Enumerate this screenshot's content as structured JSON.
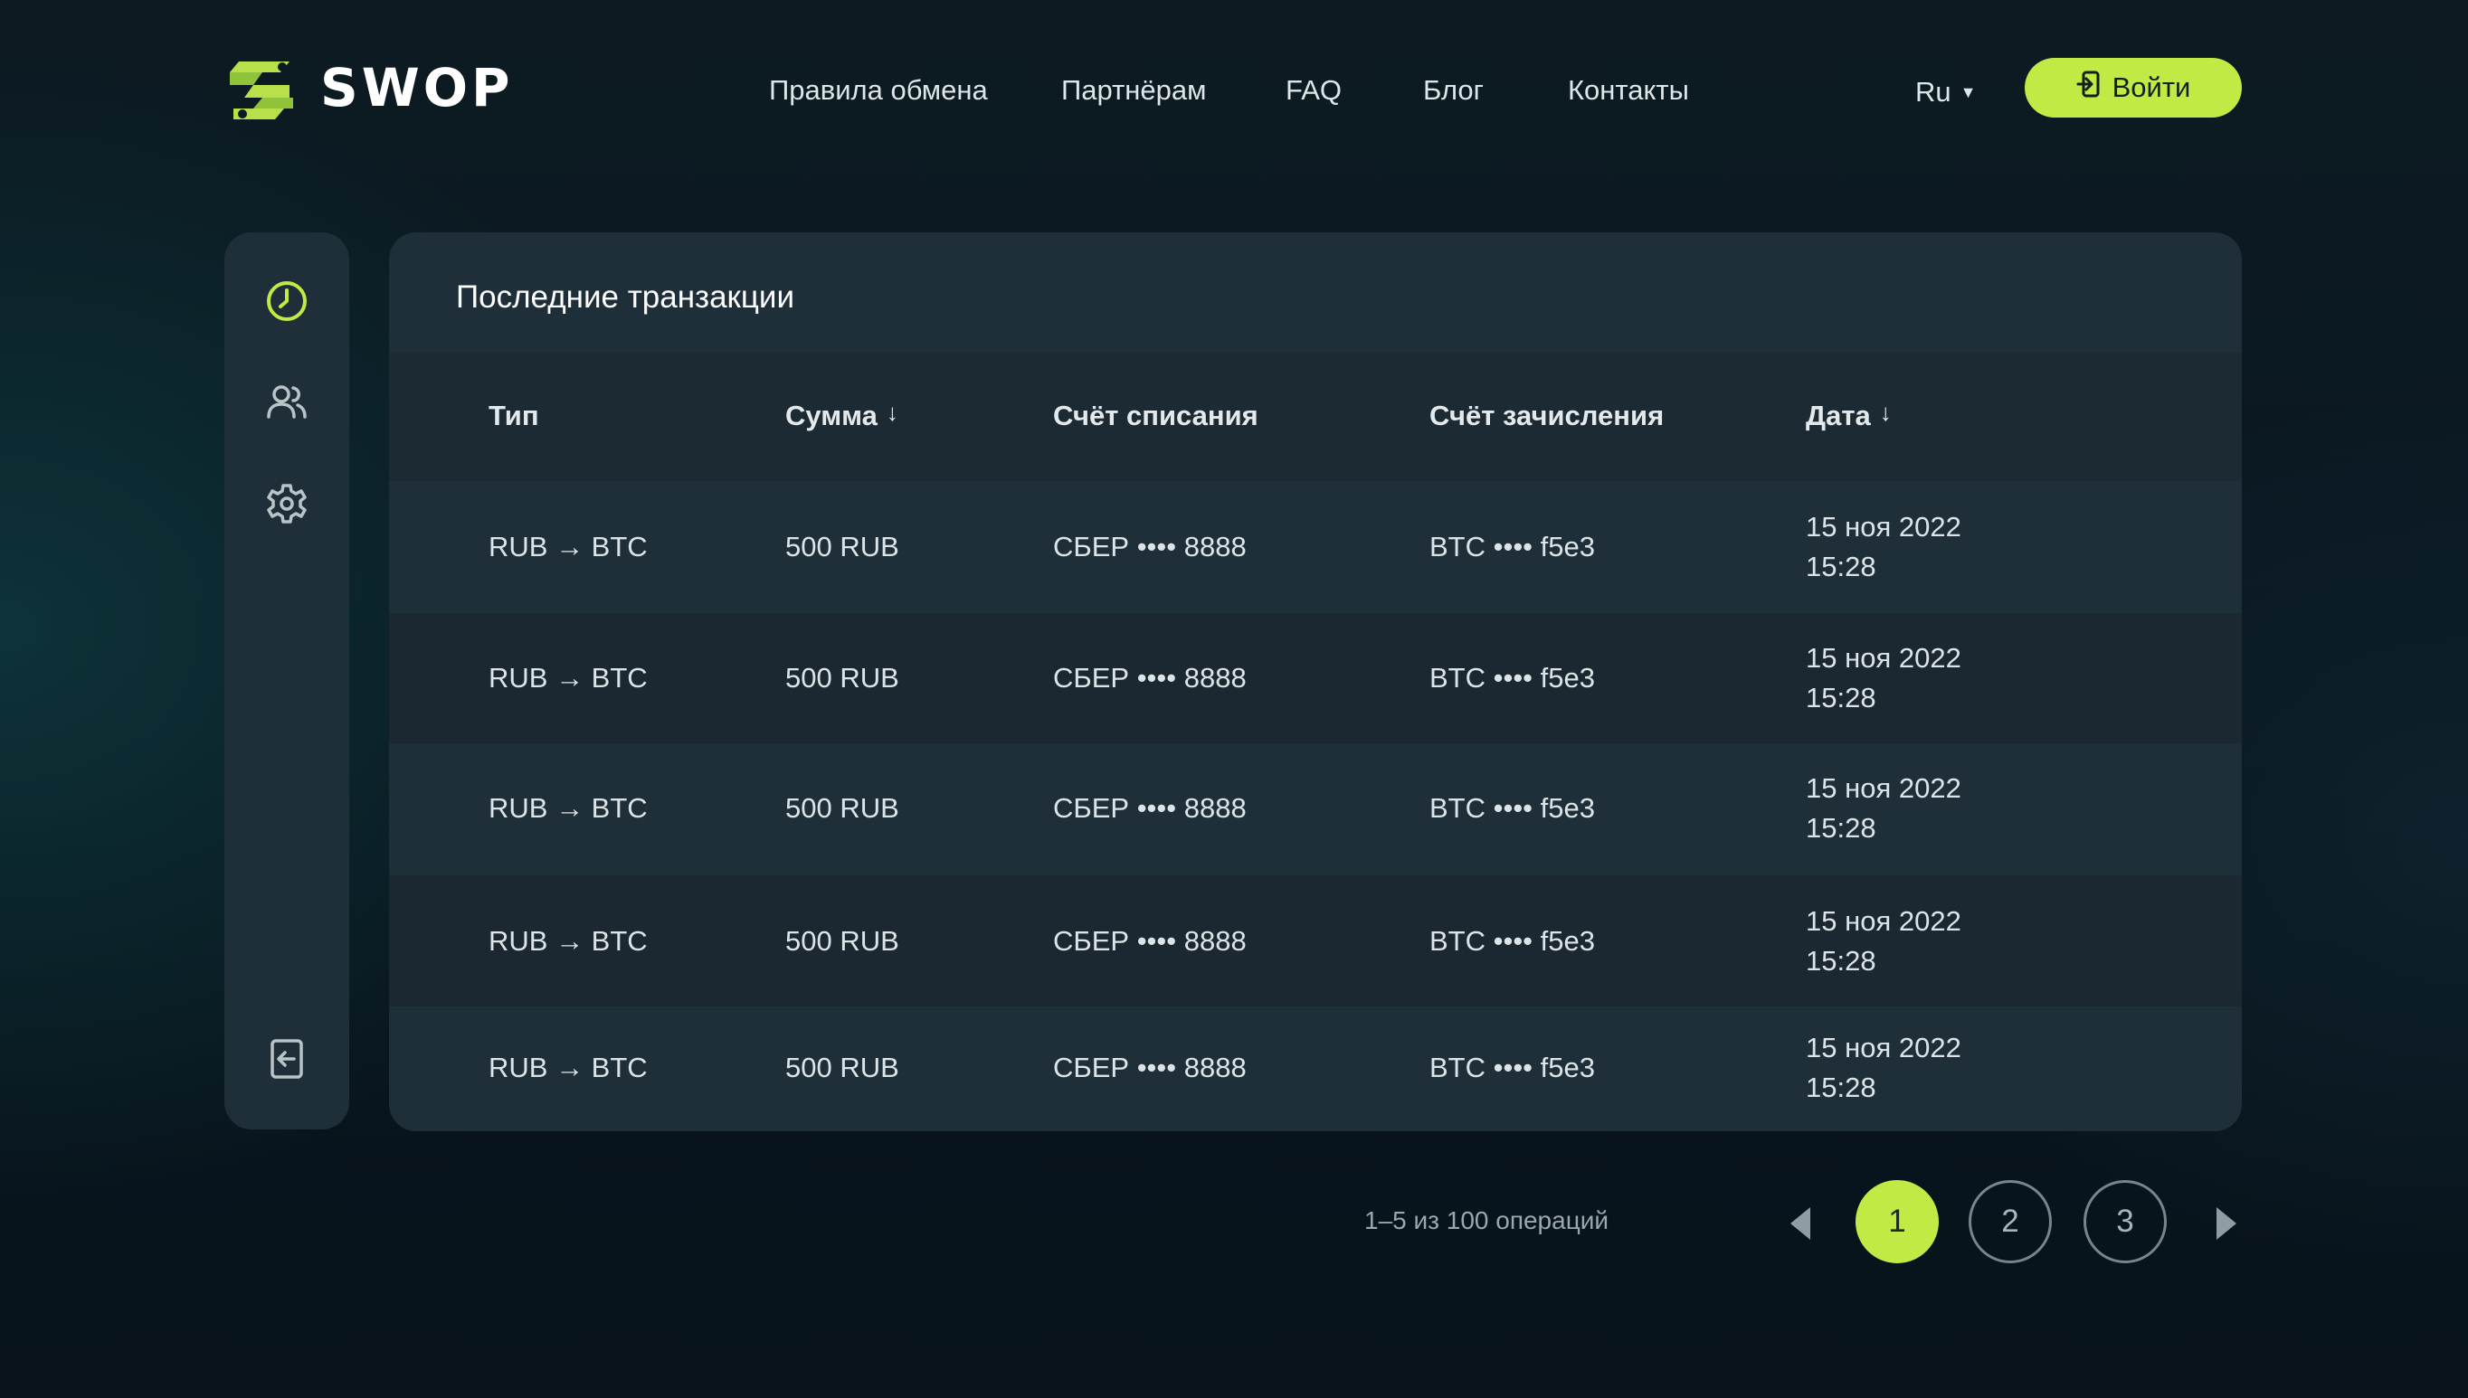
{
  "brand": {
    "name": "SWOP",
    "accent": "#c2ea45"
  },
  "nav": [
    {
      "label": "Правила обмена"
    },
    {
      "label": "Партнёрам"
    },
    {
      "label": "FAQ"
    },
    {
      "label": "Блог"
    },
    {
      "label": "Контакты"
    }
  ],
  "lang": {
    "value": "Ru",
    "icon": "caret-down-icon"
  },
  "login": {
    "label": "Войти",
    "icon": "login-icon"
  },
  "sidebar": {
    "items": [
      {
        "icon": "clock-icon",
        "active": true
      },
      {
        "icon": "users-icon",
        "active": false
      },
      {
        "icon": "gear-icon",
        "active": false
      }
    ],
    "logout_icon": "logout-icon"
  },
  "transactions": {
    "title": "Последние транзакции",
    "columns": [
      {
        "label": "Тип",
        "sortable": false
      },
      {
        "label": "Сумма",
        "sortable": true,
        "sort_glyph": "↓"
      },
      {
        "label": "Счёт списания",
        "sortable": false
      },
      {
        "label": "Счёт зачисления",
        "sortable": false
      },
      {
        "label": "Дата",
        "sortable": true,
        "sort_glyph": "↓"
      }
    ],
    "rows": [
      {
        "type": "RUB → BTC",
        "amount": "500 RUB",
        "from": "СБЕР •••• 8888",
        "to": "BTC •••• f5e3",
        "date": "15 ноя 2022",
        "time": "15:28"
      },
      {
        "type": "RUB → BTC",
        "amount": "500 RUB",
        "from": "СБЕР •••• 8888",
        "to": "BTC •••• f5e3",
        "date": "15 ноя 2022",
        "time": "15:28"
      },
      {
        "type": "RUB → BTC",
        "amount": "500 RUB",
        "from": "СБЕР •••• 8888",
        "to": "BTC •••• f5e3",
        "date": "15 ноя 2022",
        "time": "15:28"
      },
      {
        "type": "RUB → BTC",
        "amount": "500 RUB",
        "from": "СБЕР •••• 8888",
        "to": "BTC •••• f5e3",
        "date": "15 ноя 2022",
        "time": "15:28"
      },
      {
        "type": "RUB → BTC",
        "amount": "500 RUB",
        "from": "СБЕР •••• 8888",
        "to": "BTC •••• f5e3",
        "date": "15 ноя 2022",
        "time": "15:28"
      }
    ]
  },
  "pagination": {
    "info": "1–5 из 100 операций",
    "pages": [
      "1",
      "2",
      "3"
    ],
    "current": "1",
    "prev_icon": "triangle-left-icon",
    "next_icon": "triangle-right-icon"
  }
}
